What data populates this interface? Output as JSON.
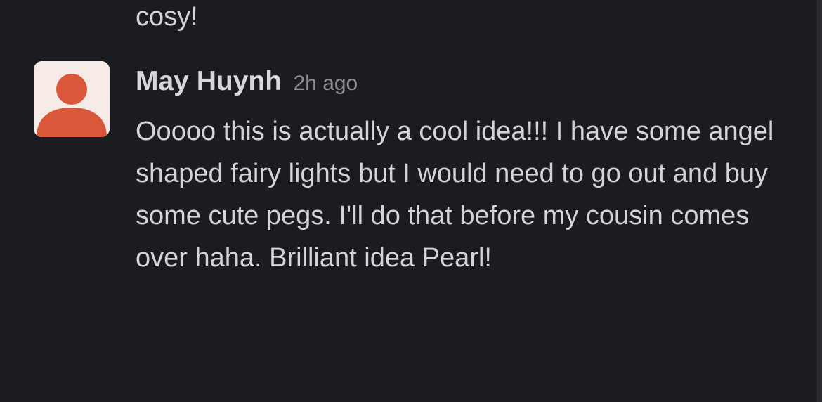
{
  "previous_message": {
    "text": "cosy!"
  },
  "message": {
    "author": "May Huynh",
    "timestamp": "2h ago",
    "body": "Ooooo this is actually a cool idea!!! I have some angel shaped fairy lights but I would need to go out and buy some cute pegs. I'll do that before my cousin comes over haha. Brilliant idea Pearl!",
    "avatar_icon": "default-user-icon"
  },
  "colors": {
    "background": "#1b1c20",
    "text": "#d4d4d6",
    "muted": "#8e8e92",
    "avatar_bg": "#f6ebe7",
    "avatar_fg": "#d9573a"
  }
}
